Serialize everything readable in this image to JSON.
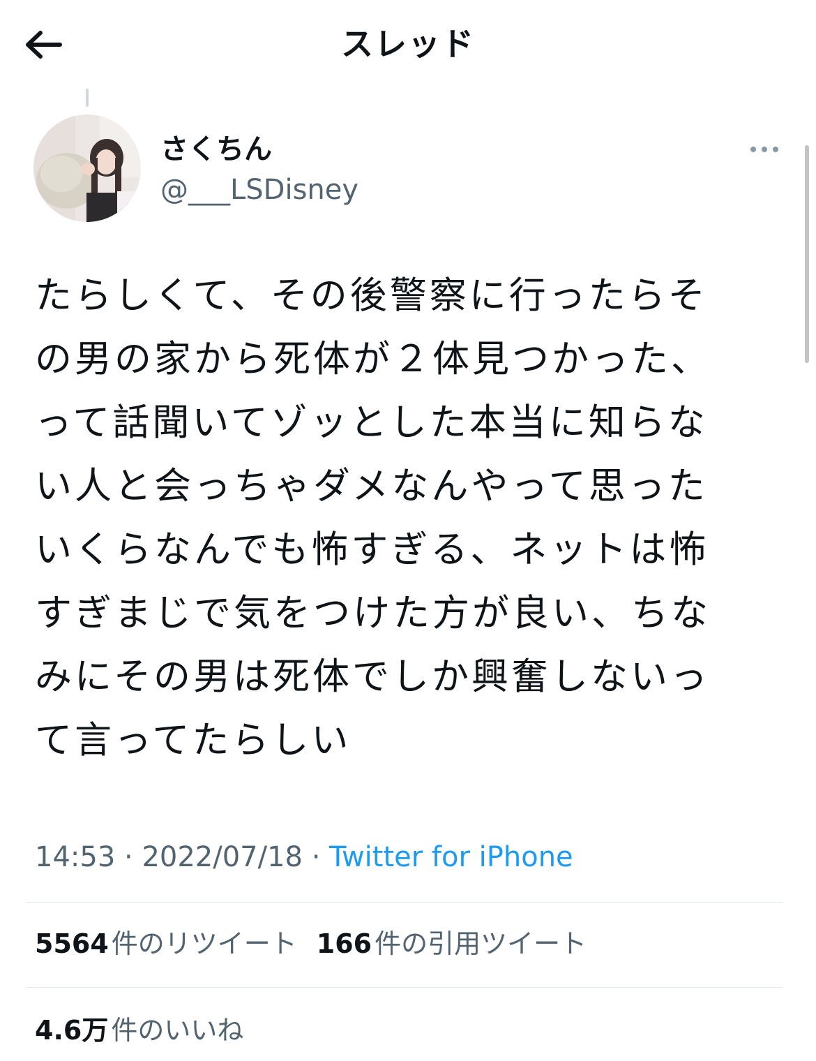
{
  "header": {
    "title": "スレッド",
    "back_icon": "arrow-left-icon"
  },
  "user": {
    "display_name": "さくちん",
    "handle": "@___LSDisney"
  },
  "tweet": {
    "lines": [
      "たらしくて、その後警察に行ったらそ",
      "の男の家から死体が２体見つかった、",
      "って話聞いてゾッとした本当に知らな",
      "い人と会っちゃダメなんやって思った",
      "いくらなんでも怖すぎる、ネットは怖",
      "すぎまじで気をつけた方が良い、ちな",
      "みにその男は死体でしか興奮しないっ",
      "て言ってたらしい"
    ]
  },
  "meta": {
    "time": "14:53",
    "separator1": " · ",
    "date": "2022/07/18",
    "separator2": " · ",
    "source": "Twitter for iPhone"
  },
  "stats": {
    "retweets": {
      "count": "5564",
      "label": "件のリツイート"
    },
    "quotes": {
      "count": "166",
      "label": "件の引用ツイート"
    },
    "likes": {
      "count": "4.6万",
      "label": "件のいいね"
    }
  },
  "colors": {
    "text": "#0f1419",
    "secondary": "#536471",
    "link": "#1d9bf0",
    "divider": "#e1e8ed"
  }
}
